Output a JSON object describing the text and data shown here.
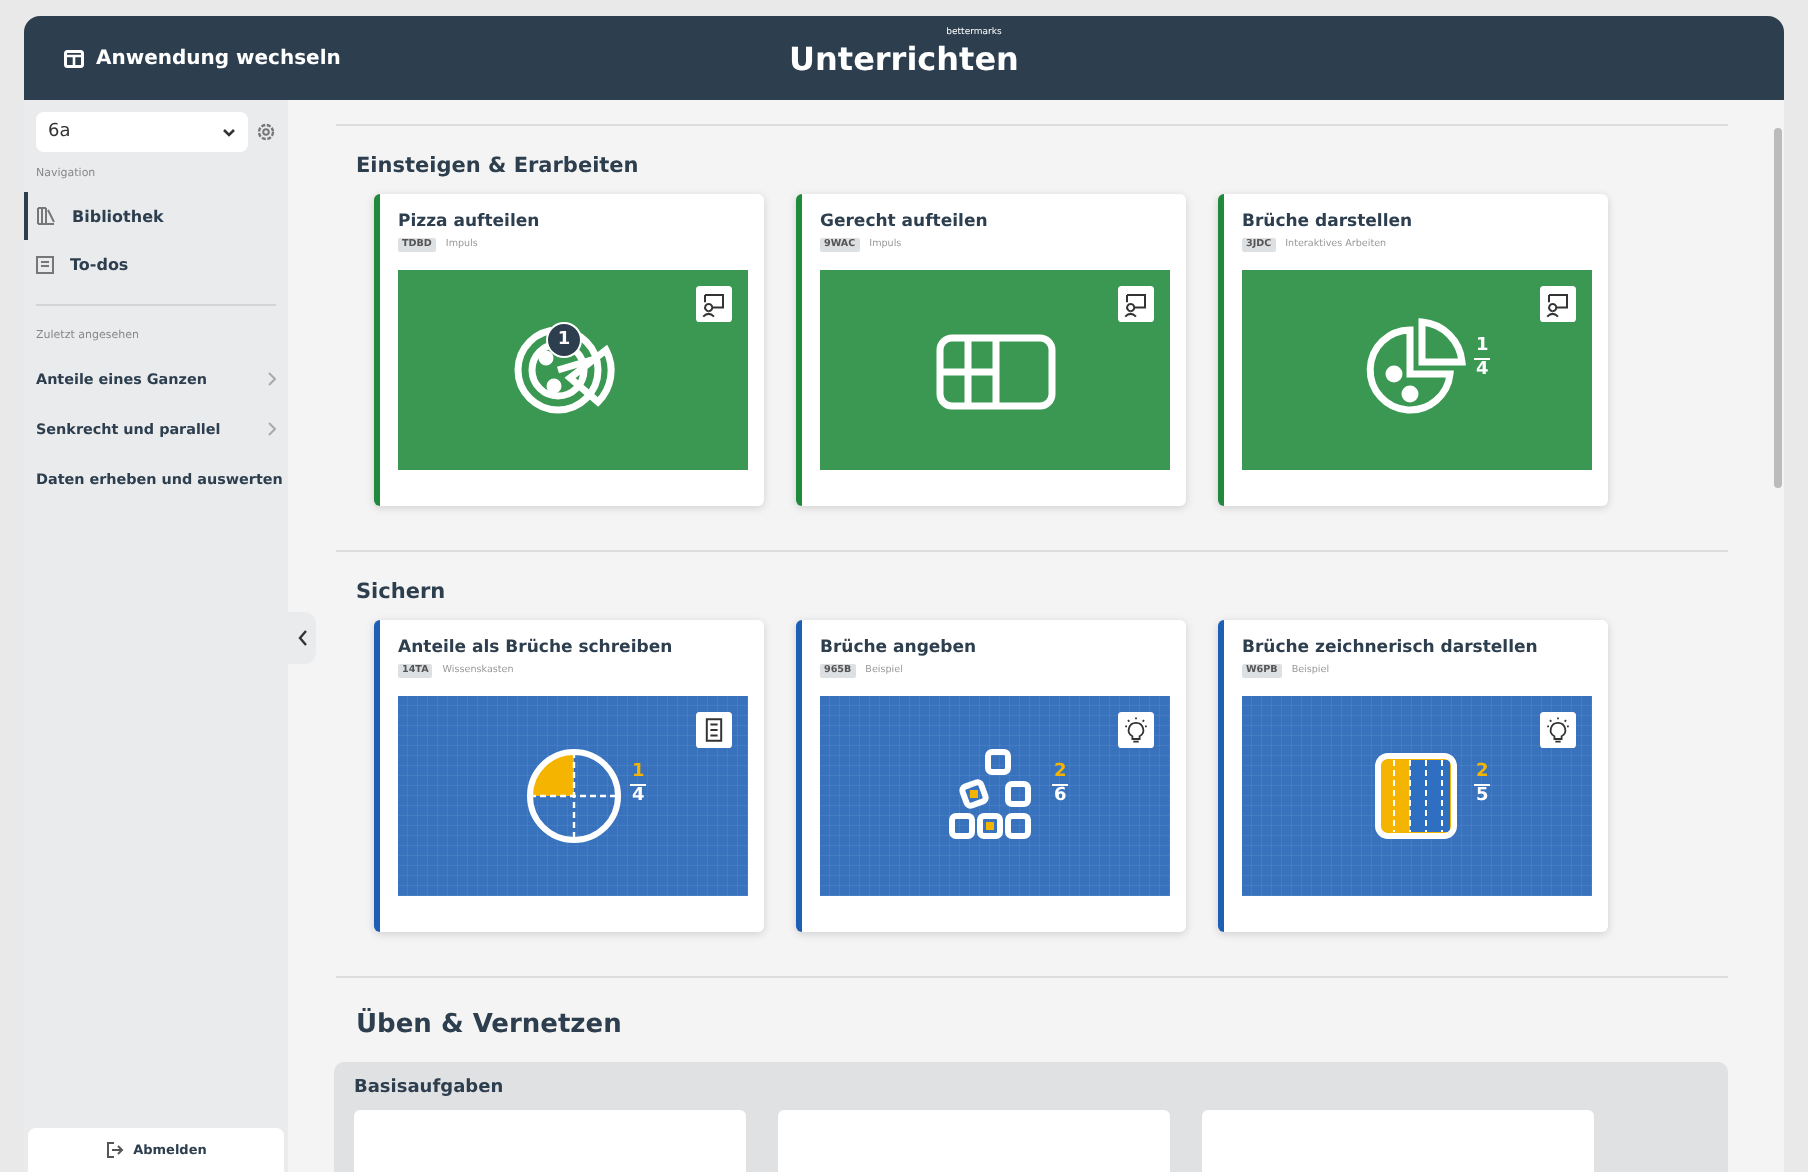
{
  "header": {
    "switch_label": "Anwendung wechseln",
    "brand": "bettermarks",
    "title": "Unterrichten"
  },
  "sidebar": {
    "class_select": "6a",
    "nav_heading": "Navigation",
    "nav_items": [
      {
        "label": "Bibliothek",
        "kind": "library",
        "selected": true
      },
      {
        "label": "To-dos",
        "kind": "todo",
        "selected": false
      }
    ],
    "recent_heading": "Zuletzt angesehen",
    "recent_items": [
      "Anteile eines Ganzen",
      "Senkrecht und parallel",
      "Daten erheben und auswerten"
    ],
    "logout": "Abmelden"
  },
  "sections": [
    {
      "title": "Einsteigen & Erarbeiten",
      "color": "#1f8a3b",
      "cards": [
        {
          "title": "Pizza aufteilen",
          "code": "TDBD",
          "type": "Impuls",
          "kind": "pizza",
          "badge": "1"
        },
        {
          "title": "Gerecht aufteilen",
          "code": "9WAC",
          "type": "Impuls",
          "kind": "chocolate"
        },
        {
          "title": "Brüche darstellen",
          "code": "3JDC",
          "type": "Interaktives Arbeiten",
          "kind": "pie",
          "numerator": "1",
          "denominator": "4"
        }
      ]
    },
    {
      "title": "Sichern",
      "color": "#1d5fb4",
      "cards": [
        {
          "title": "Anteile als Brüche schreiben",
          "code": "14TA",
          "type": "Wissenskasten",
          "kind": "circle",
          "numerator": "1",
          "denominator": "4"
        },
        {
          "title": "Brüche angeben",
          "code": "965B",
          "type": "Beispiel",
          "kind": "cubes",
          "numerator": "2",
          "denominator": "6"
        },
        {
          "title": "Brüche zeichnerisch darstellen",
          "code": "W6PB",
          "type": "Beispiel",
          "kind": "bar",
          "numerator": "2",
          "denominator": "5"
        }
      ]
    }
  ],
  "practice": {
    "title": "Üben & Vernetzen",
    "group": "Basisaufgaben"
  }
}
